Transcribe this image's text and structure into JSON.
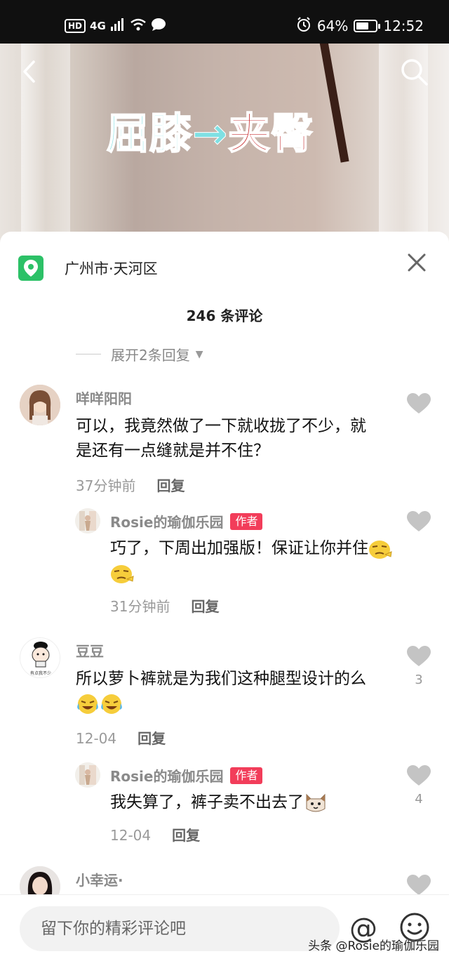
{
  "status_bar": {
    "hd": "HD",
    "network": "4G",
    "battery_percent": "64%",
    "battery_level": 0.64,
    "time": "12:52"
  },
  "video": {
    "caption_part1": "屈膝",
    "caption_arrow": "→",
    "caption_part2": "夹臀"
  },
  "panel": {
    "location": "广州市·天河区",
    "comment_count": "246 条评论",
    "expand_replies": "展开2条回复"
  },
  "comments": [
    {
      "author": "咩咩阳阳",
      "text": "可以，我竟然做了一下就收拢了不少，就是还有一点缝就是并不住？",
      "time": "37分钟前",
      "reply_label": "回复",
      "likes": ""
    },
    {
      "author": "Rosie的瑜伽乐园",
      "badge": "作者",
      "text": "巧了，下周出加强版！保证让你并住",
      "time": "31分钟前",
      "reply_label": "回复",
      "likes": ""
    },
    {
      "author": "豆豆",
      "avatar_text": "有点我不少",
      "text": "所以萝卜裤就是为我们这种腿型设计的么",
      "time": "12-04",
      "reply_label": "回复",
      "likes": "3"
    },
    {
      "author": "Rosie的瑜伽乐园",
      "badge": "作者",
      "text": "我失算了，裤子卖不出去了",
      "time": "12-04",
      "reply_label": "回复",
      "likes": "4"
    },
    {
      "author": "小幸运·"
    }
  ],
  "input": {
    "placeholder": "留下你的精彩评论吧",
    "at_symbol": "@"
  },
  "watermark": "头条 @Rosie的瑜伽乐园",
  "colors": {
    "accent_badge": "#f23d5a",
    "location_icon": "#2cc167"
  }
}
